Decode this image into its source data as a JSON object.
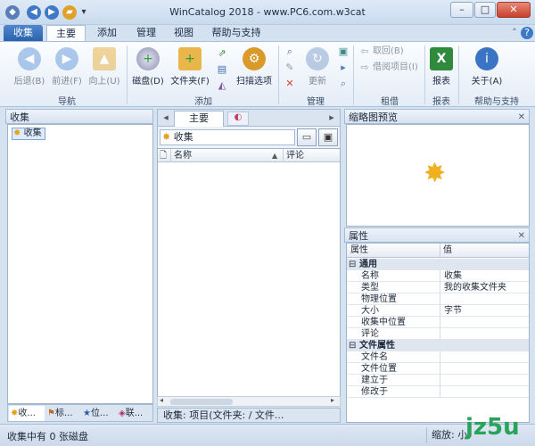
{
  "window": {
    "title": "WinCatalog 2018 - www.PC6.com.w3cat",
    "minimize": "–",
    "maximize": "□",
    "close": "✕"
  },
  "ribbon_tabs": [
    "收集",
    "主要",
    "添加",
    "管理",
    "视图",
    "帮助与支持"
  ],
  "ribbon": {
    "back": "后退(B)",
    "forward": "前进(F)",
    "up": "向上(U)",
    "nav_group": "导航",
    "disk": "磁盘(D)",
    "folder": "文件夹(F)",
    "scan": "扫描选项",
    "add_group": "添加",
    "update": "更新",
    "manage_group": "管理",
    "return": "取回(B)",
    "lend": "借阅项目(I)",
    "lend_group": "租借",
    "report": "报表",
    "report_group": "报表",
    "about": "关于(A)",
    "help_group": "帮助与支持"
  },
  "left_panel": {
    "header": "收集",
    "tree_root": "收集",
    "bottom_tabs": [
      "收...",
      "标...",
      "位...",
      "联..."
    ]
  },
  "middle_panel": {
    "tab_main": "主要",
    "path": "收集",
    "col_name": "名称",
    "col_comment": "评论",
    "footer": "收集:  项目(文件夹: / 文件..."
  },
  "thumb_panel": {
    "header": "缩略图预览"
  },
  "props_panel": {
    "header": "属性",
    "col_prop": "属性",
    "col_val": "值",
    "cat_general": "通用",
    "rows_general": [
      {
        "k": "名称",
        "v": "收集"
      },
      {
        "k": "类型",
        "v": "我的收集文件夹"
      },
      {
        "k": "物理位置",
        "v": ""
      },
      {
        "k": "大小",
        "v": "字节"
      },
      {
        "k": "收集中位置",
        "v": ""
      },
      {
        "k": "评论",
        "v": ""
      }
    ],
    "cat_file": "文件属性",
    "rows_file": [
      {
        "k": "文件名",
        "v": ""
      },
      {
        "k": "文件位置",
        "v": ""
      },
      {
        "k": "建立于",
        "v": ""
      },
      {
        "k": "修改于",
        "v": ""
      }
    ]
  },
  "status": {
    "text": "收集中有 0 张磁盘",
    "zoom_label": "缩放:",
    "zoom_value": "小",
    "watermark": "jz5u"
  },
  "colors": {
    "accent": "#2b6dbd",
    "tab_active": "#ffffff"
  }
}
